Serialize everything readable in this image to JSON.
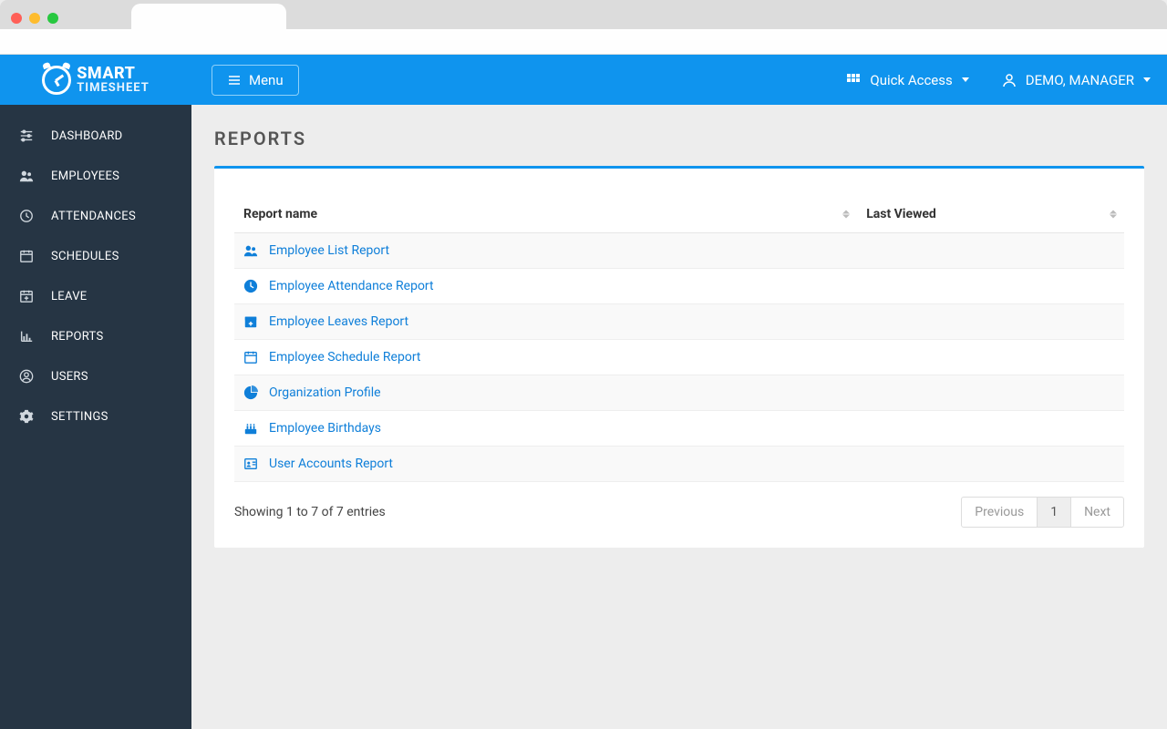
{
  "chrome": {},
  "logo": {
    "line1": "SMART",
    "line2": "TIMESHEET"
  },
  "topbar": {
    "menu_label": "Menu",
    "quick_access_label": "Quick Access",
    "user_label": "DEMO, MANAGER"
  },
  "sidebar": {
    "items": [
      {
        "label": "DASHBOARD",
        "icon": "sliders-icon"
      },
      {
        "label": "EMPLOYEES",
        "icon": "users-icon"
      },
      {
        "label": "ATTENDANCES",
        "icon": "clock-icon"
      },
      {
        "label": "SCHEDULES",
        "icon": "calendar-icon"
      },
      {
        "label": "LEAVE",
        "icon": "calendar-plus-icon"
      },
      {
        "label": "REPORTS",
        "icon": "bar-chart-icon"
      },
      {
        "label": "USERS",
        "icon": "user-circle-icon"
      },
      {
        "label": "SETTINGS",
        "icon": "gear-icon"
      }
    ]
  },
  "page": {
    "title": "REPORTS",
    "columns": {
      "name": "Report name",
      "last_viewed": "Last Viewed"
    },
    "rows": [
      {
        "label": "Employee List Report",
        "icon": "users-icon"
      },
      {
        "label": "Employee Attendance Report",
        "icon": "clock-solid-icon"
      },
      {
        "label": "Employee Leaves Report",
        "icon": "calendar-plus-icon"
      },
      {
        "label": "Employee Schedule Report",
        "icon": "calendar-icon"
      },
      {
        "label": "Organization Profile",
        "icon": "pie-chart-icon"
      },
      {
        "label": "Employee Birthdays",
        "icon": "birthday-icon"
      },
      {
        "label": "User Accounts Report",
        "icon": "id-card-icon"
      }
    ],
    "footer_summary": "Showing 1 to 7 of 7 entries",
    "pager": {
      "prev": "Previous",
      "page": "1",
      "next": "Next"
    }
  }
}
